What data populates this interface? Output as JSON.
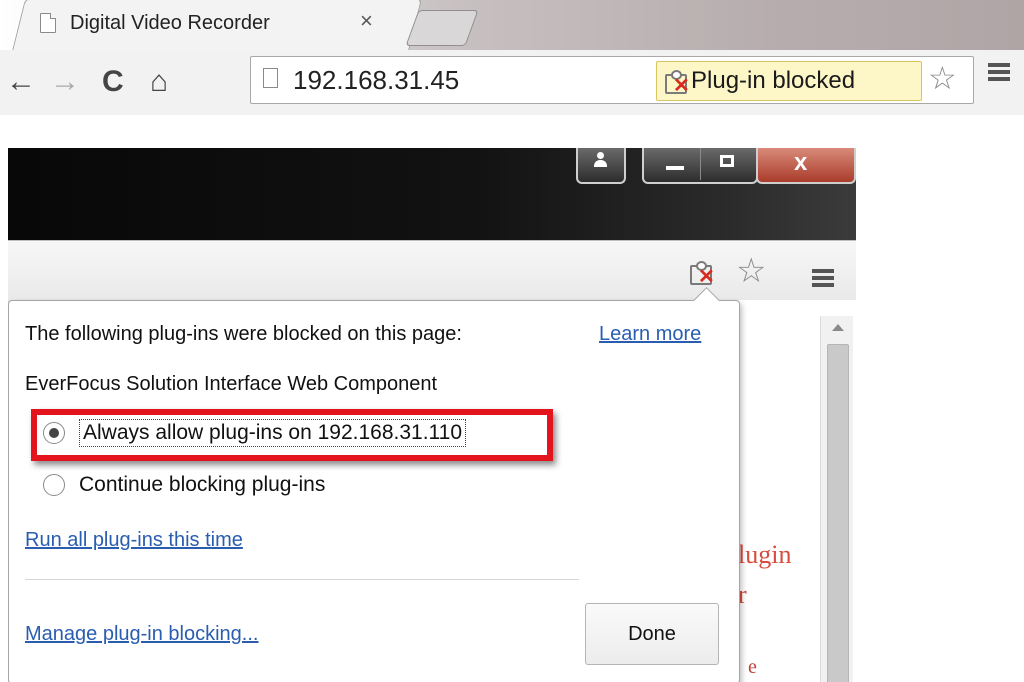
{
  "browser": {
    "tab_title": "Digital Video Recorder",
    "tab_close": "×",
    "address": "192.168.31.45",
    "blocked_chip_label": "Plug-in blocked",
    "nav": {
      "back": "←",
      "forward": "→",
      "reload": "C",
      "home": "⌂"
    },
    "star": "☆"
  },
  "window": {
    "close_label": "x"
  },
  "bubble": {
    "heading": "The following plug-ins were blocked on this page:",
    "learn_more": "Learn more",
    "plugin_name": "EverFocus Solution Interface Web Component",
    "options": [
      {
        "label": "Always allow plug-ins on 192.168.31.110",
        "selected": true
      },
      {
        "label": "Continue blocking plug-ins",
        "selected": false
      }
    ],
    "run_all": "Run all plug-ins this time",
    "manage": "Manage plug-in blocking...",
    "done": "Done"
  },
  "page_behind": {
    "text_1": "lugin",
    "text_2": "r",
    "text_3": "e"
  },
  "colors": {
    "link": "#2a5db0",
    "highlight": "#e3141b",
    "blocked_chip_bg": "#fdf7c8",
    "blocked_x": "#d62b1f",
    "behind_text": "#d84b3e"
  },
  "icons": [
    "page-icon",
    "close-icon",
    "back-icon",
    "forward-icon",
    "reload-icon",
    "home-icon",
    "puzzle-blocked-icon",
    "star-icon",
    "menu-icon",
    "user-icon",
    "minimize-icon",
    "maximize-icon",
    "radio-icon",
    "scroll-up-icon"
  ]
}
